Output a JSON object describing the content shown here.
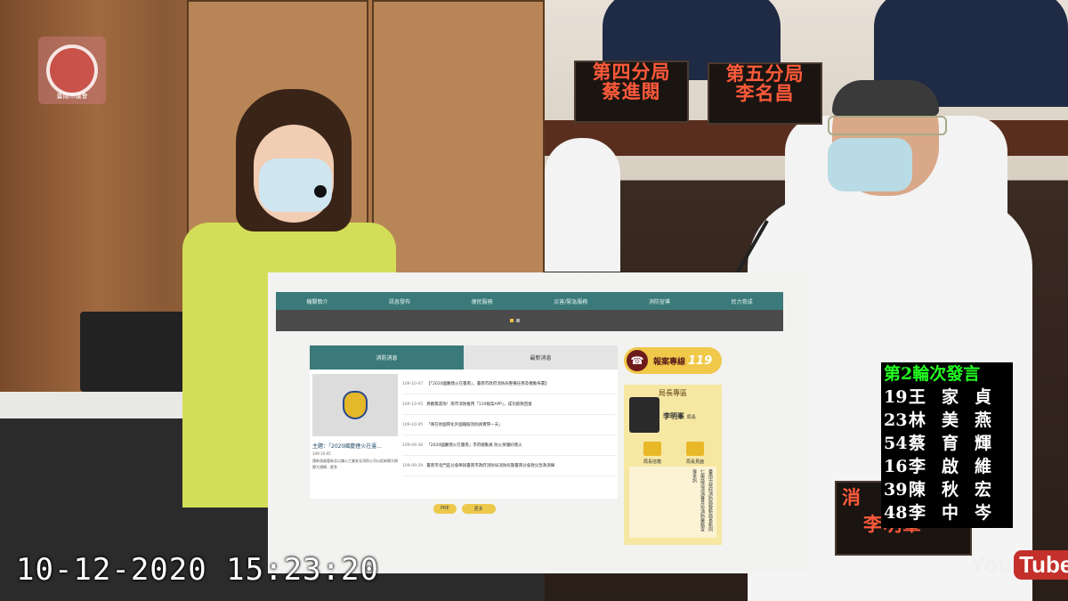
{
  "overlay": {
    "timestamp": "10-12-2020  15:23:20",
    "youtube_you": "You",
    "youtube_tube": "Tube"
  },
  "namecards": [
    {
      "dept": "第四分局",
      "name": "蔡進閱"
    },
    {
      "dept": "第五分局",
      "name": "李名昌"
    },
    {
      "dept": "消",
      "name": "李明峯"
    }
  ],
  "speaker_board": {
    "header": "第2輪次發言",
    "rows": [
      {
        "num": "19",
        "name": "王家貞"
      },
      {
        "num": "23",
        "name": "林美燕"
      },
      {
        "num": "54",
        "name": "蔡育輝"
      },
      {
        "num": "16",
        "name": "李啟維"
      },
      {
        "num": "39",
        "name": "陳秋宏"
      },
      {
        "num": "48",
        "name": "李中岑"
      }
    ]
  },
  "website": {
    "nav": [
      "機關簡介",
      "訊息發布",
      "便民服務",
      "災害/緊急服務",
      "消防宣導",
      "民力育成"
    ],
    "tabs": {
      "active": "消防消息",
      "inactive": "最新消息"
    },
    "featured": {
      "title": "主題：「2020國慶煙火在臺...",
      "date": "109-10-05",
      "excerpt": "請新發展看新北以鎮火工業安全消防公司以從新開大稀膠大規模…更多"
    },
    "news": [
      {
        "date": "109-10-07",
        "text": "【「2020國慶煙火在臺南」，臺南市政府消防局整備任務及機動佈署】"
      },
      {
        "date": "109-10-05",
        "text": "異觀無底限！南市消防推用「119報案APP」，成功搶救回復"
      },
      {
        "date": "109-10-05",
        "text": "「將在地國際化外國籍服消防員實際一天」"
      },
      {
        "date": "109-09-30",
        "text": "「2020國慶煙火在臺南」市府總動員 防火保護好煙火"
      },
      {
        "date": "109-09-29",
        "text": "臺南市北門區分會舉辦臺南市政府消防局消防局暨臺南分會救災急救演練"
      }
    ],
    "pager": [
      "PRE",
      "更多"
    ],
    "hotline": {
      "label": "報案專線",
      "number": "119"
    },
    "chief": {
      "header": "局長專區",
      "name": "李明峯",
      "title": "局長",
      "icon1": "局長信箱",
      "icon2": "局長見面",
      "letter": "臺南市政府消防局致新局長新同仁座談清涼消暑月份消防業務宣導來訊"
    }
  },
  "logo": {
    "caption": "臺南市議會"
  }
}
